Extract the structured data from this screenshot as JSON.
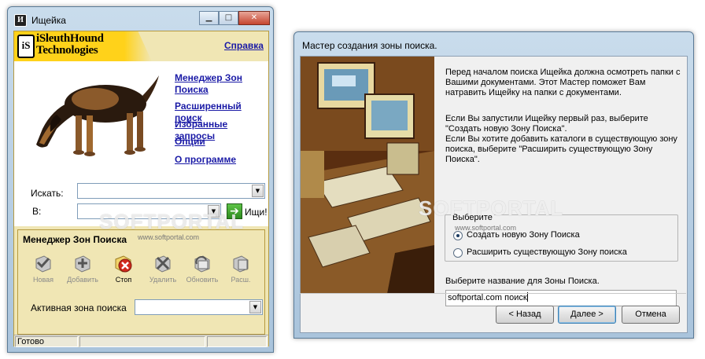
{
  "left_window": {
    "title": "Ищейка",
    "app_icon_letter": "И",
    "caption_buttons": {
      "minimize": "▁",
      "maximize": "□",
      "close": "✕"
    },
    "logo": {
      "mark": "iS",
      "line1": "iSleuthHound",
      "line2": "Technologies"
    },
    "help_link": "Справка",
    "nav_links": [
      "Менеджер Зон Поиска",
      "Расширенный поиск",
      "Избранные запросы",
      "Опции",
      "О программе"
    ],
    "search_label": "Искать:",
    "search_value": "",
    "in_label": "В:",
    "in_value": "",
    "go_button_icon": "arrow-right-icon",
    "go_button_label": "Ищи!",
    "zone_manager": {
      "title": "Менеджер Зон Поиска",
      "toolbar": [
        {
          "label": "Новая",
          "icon": "new-zone-icon",
          "enabled": false
        },
        {
          "label": "Добавить",
          "icon": "add-icon",
          "enabled": false
        },
        {
          "label": "Стоп",
          "icon": "stop-icon",
          "enabled": true
        },
        {
          "label": "Удалить",
          "icon": "delete-icon",
          "enabled": false
        },
        {
          "label": "Обновить",
          "icon": "refresh-icon",
          "enabled": false
        },
        {
          "label": "Расш.",
          "icon": "expand-icon",
          "enabled": false
        }
      ],
      "active_zone_label": "Активная зона поиска",
      "active_zone_value": ""
    },
    "status": {
      "text": "Готово"
    },
    "watermark": {
      "text": "SOFTPORTAL",
      "url": "www.softportal.com"
    }
  },
  "right_window": {
    "title": "Мастер создания зоны поиска.",
    "intro": "Перед началом поиска Ищейка должна осмотреть папки с Вашими документами. Этот Мастер поможет Вам натравить Ищейку на папки с документами.",
    "instructions": "Если Вы запустили Ищейку первый раз, выберите \"Создать новую Зону Поиска\".\nЕсли Вы хотите добавить каталоги в существующую зону поиска, выберите \"Расширить существующую Зону Поиска\".",
    "choose_group_label": "Выберите",
    "options": [
      {
        "label": "Создать новую Зону Поиска",
        "selected": true
      },
      {
        "label": "Расширить существующую Зону поиска",
        "selected": false
      }
    ],
    "name_prompt": "Выберите название для Зоны Поиска.",
    "name_value": "softportal.com поиск",
    "buttons": {
      "back": "< Назад",
      "next": "Далее >",
      "cancel": "Отмена"
    },
    "watermark": {
      "text": "SOFTPORTAL",
      "url": "www.softportal.com"
    }
  },
  "colors": {
    "link": "#1a1aa6",
    "panel_yellow": "#f0e6b4",
    "logo_yellow": "#ffd21a",
    "go_green": "#2c8a1e",
    "stop_red": "#d12a1c"
  }
}
